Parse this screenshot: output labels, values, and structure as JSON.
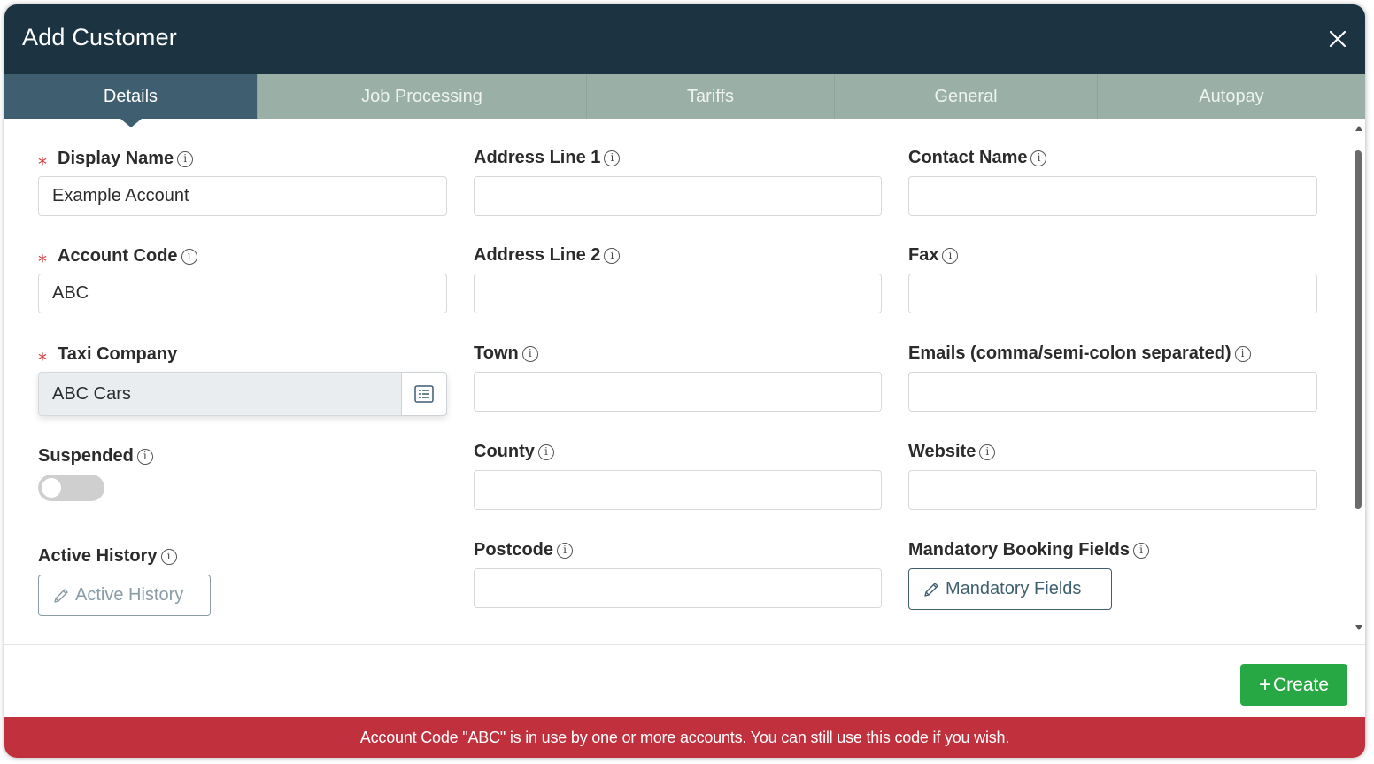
{
  "dialog": {
    "title": "Add Customer"
  },
  "tabs": [
    {
      "label": "Details",
      "active": true
    },
    {
      "label": "Job Processing",
      "active": false
    },
    {
      "label": "Tariffs",
      "active": false
    },
    {
      "label": "General",
      "active": false
    },
    {
      "label": "Autopay",
      "active": false
    }
  ],
  "form": {
    "display_name": {
      "label": "Display Name",
      "value": "Example Account",
      "required": true
    },
    "account_code": {
      "label": "Account Code",
      "value": "ABC",
      "required": true
    },
    "taxi_company": {
      "label": "Taxi Company",
      "value": "ABC Cars",
      "required": true
    },
    "suspended": {
      "label": "Suspended",
      "checked": false
    },
    "active_history": {
      "label": "Active History",
      "button": "Active History"
    },
    "address_line_1": {
      "label": "Address Line 1",
      "value": ""
    },
    "address_line_2": {
      "label": "Address Line 2",
      "value": ""
    },
    "town": {
      "label": "Town",
      "value": ""
    },
    "county": {
      "label": "County",
      "value": ""
    },
    "postcode": {
      "label": "Postcode",
      "value": ""
    },
    "contact_name": {
      "label": "Contact Name",
      "value": ""
    },
    "fax": {
      "label": "Fax",
      "value": ""
    },
    "emails": {
      "label": "Emails (comma/semi-colon separated)",
      "value": ""
    },
    "website": {
      "label": "Website",
      "value": ""
    },
    "mandatory_booking_fields": {
      "label": "Mandatory Booking Fields",
      "button": "Mandatory Fields"
    }
  },
  "footer": {
    "create_label": "Create"
  },
  "banner": {
    "message": "Account Code \"ABC\" is in use by one or more accounts. You can still use this code if you wish."
  },
  "icons": {
    "info": "i",
    "close": "close-icon",
    "pencil": "pencil-icon",
    "list": "list-icon",
    "plus": "+",
    "required": "⁎"
  },
  "colors": {
    "header_bg": "#1c3441",
    "tab_active": "#3f5f70",
    "tab_inactive": "#9aafa5",
    "required": "#d23c3c",
    "create": "#28a745",
    "banner": "#c0303d"
  }
}
